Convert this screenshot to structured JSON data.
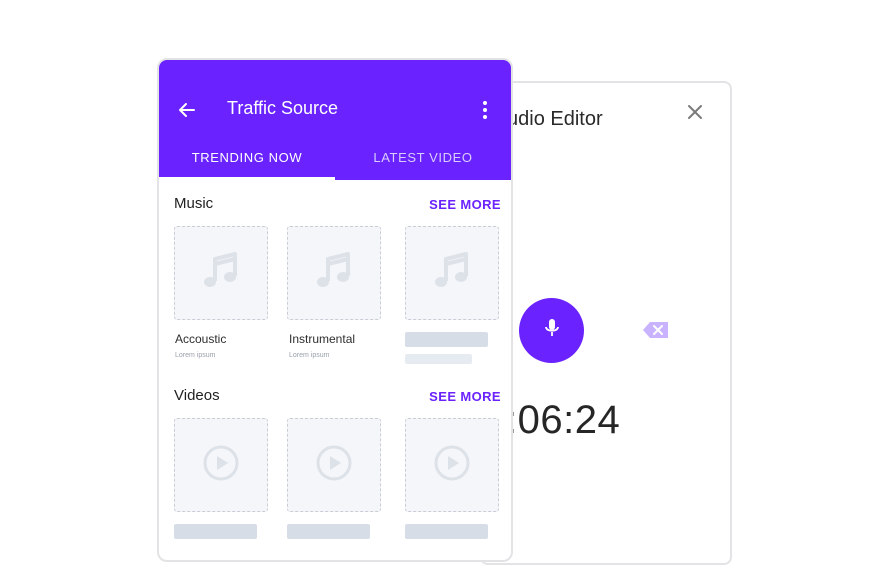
{
  "audio_editor": {
    "title": "udio Editor",
    "timer": ":06:24"
  },
  "traffic_source": {
    "title": "Traffic Source",
    "tabs": [
      {
        "label": "TRENDING NOW",
        "active": true
      },
      {
        "label": "LATEST VIDEO",
        "active": false
      }
    ],
    "sections": [
      {
        "title": "Music",
        "see_more": "SEE MORE",
        "items": [
          {
            "label": "Accoustic",
            "sub": "Lorem ipsum"
          },
          {
            "label": "Instrumental",
            "sub": "Lorem ipsum"
          },
          {
            "label": "",
            "sub": ""
          }
        ]
      },
      {
        "title": "Videos",
        "see_more": "SEE MORE",
        "items": [
          {
            "label": "",
            "sub": ""
          },
          {
            "label": "",
            "sub": ""
          },
          {
            "label": "",
            "sub": ""
          }
        ]
      }
    ]
  },
  "colors": {
    "accent": "#6a22ff",
    "tab_inactive": "#d9cdfc",
    "placeholder": "#d7dde6",
    "tile_bg": "#f4f6f9"
  },
  "icons": [
    "arrow-back-icon",
    "more-vert-icon",
    "music-note-icon",
    "play-circle-icon",
    "mic-icon",
    "close-icon",
    "backspace-icon"
  ]
}
